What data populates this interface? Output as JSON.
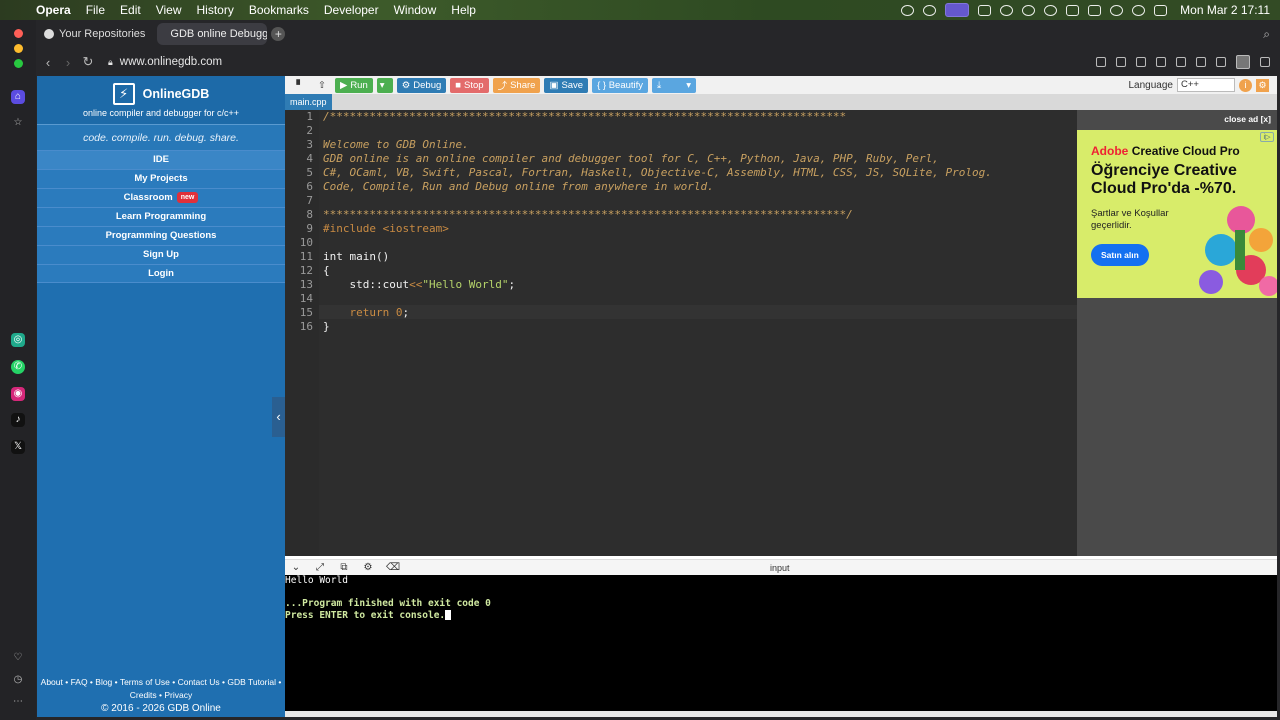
{
  "os_menubar": {
    "app": "Opera",
    "menus": [
      "File",
      "Edit",
      "View",
      "History",
      "Bookmarks",
      "Developer",
      "Window",
      "Help"
    ],
    "clock": "Mon Mar 2  17:11"
  },
  "browser": {
    "tabs": [
      {
        "label": "Your Repositories"
      },
      {
        "label": "GDB online Debugger | C"
      }
    ],
    "url": "www.onlinegdb.com"
  },
  "site": {
    "name": "OnlineGDB",
    "subtitle": "online compiler and debugger for c/c++",
    "tagline": "code. compile. run. debug. share.",
    "nav": [
      {
        "label": "IDE"
      },
      {
        "label": "My Projects"
      },
      {
        "label": "Classroom",
        "badge": "new"
      },
      {
        "label": "Learn Programming"
      },
      {
        "label": "Programming Questions"
      },
      {
        "label": "Sign Up"
      },
      {
        "label": "Login"
      }
    ],
    "footer": {
      "links_line1": "About • FAQ • Blog • Terms of Use • Contact Us • GDB Tutorial •",
      "links_line2": "Credits • Privacy",
      "copyright": "© 2016 - 2026 GDB Online"
    }
  },
  "toolbar": {
    "run": "Run",
    "debug": "Debug",
    "stop": "Stop",
    "share": "Share",
    "save": "Save",
    "beautify": "{ } Beautify",
    "language_label": "Language",
    "language_value": "C++"
  },
  "file_tab": "main.cpp",
  "code": {
    "lines": [
      {
        "n": "1",
        "text": "/******************************************************************************",
        "cls": "cmt"
      },
      {
        "n": "2",
        "text": "",
        "cls": "cmt"
      },
      {
        "n": "3",
        "text": "Welcome to GDB Online.",
        "cls": "cmt"
      },
      {
        "n": "4",
        "text": "GDB online is an online compiler and debugger tool for C, C++, Python, Java, PHP, Ruby, Perl,",
        "cls": "cmt"
      },
      {
        "n": "5",
        "text": "C#, OCaml, VB, Swift, Pascal, Fortran, Haskell, Objective-C, Assembly, HTML, CSS, JS, SQLite, Prolog.",
        "cls": "cmt"
      },
      {
        "n": "6",
        "text": "Code, Compile, Run and Debug online from anywhere in world.",
        "cls": "cmt"
      },
      {
        "n": "7",
        "text": "",
        "cls": "cmt"
      },
      {
        "n": "8",
        "text": "*******************************************************************************/",
        "cls": "cmt"
      },
      {
        "n": "9",
        "text": "#include <iostream>",
        "cls": "pp"
      },
      {
        "n": "10",
        "text": "",
        "cls": "plain"
      },
      {
        "n": "11",
        "text": "int main()",
        "cls": "plain"
      },
      {
        "n": "12",
        "text": "{",
        "cls": "plain"
      },
      {
        "n": "13",
        "text": "    std::cout<<\"Hello World\";",
        "cls": "mixed13"
      },
      {
        "n": "14",
        "text": "",
        "cls": "plain"
      },
      {
        "n": "15",
        "text": "    return 0;",
        "cls": "mixed15"
      },
      {
        "n": "16",
        "text": "}",
        "cls": "plain"
      }
    ]
  },
  "ad": {
    "close": "close ad [x]",
    "brand_prefix": "Adobe",
    "brand_rest": "Creative Cloud Pro",
    "headline": "Öğrenciye Creative Cloud Pro'da -%70.",
    "terms": "Şartlar ve Koşullar geçerlidir.",
    "button": "Satın alın"
  },
  "console": {
    "input_label": "input",
    "output": "Hello World",
    "finished": "...Program finished with exit code 0",
    "prompt": "Press ENTER to exit console."
  }
}
